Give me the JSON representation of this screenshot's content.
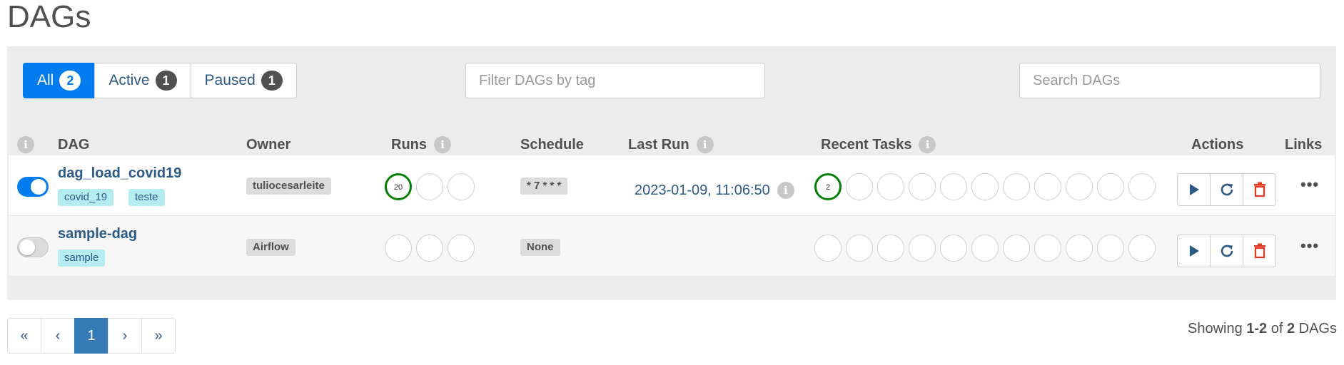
{
  "page": {
    "title": "DAGs"
  },
  "filters": {
    "all": {
      "label": "All",
      "count": "2"
    },
    "active": {
      "label": "Active",
      "count": "1"
    },
    "paused": {
      "label": "Paused",
      "count": "1"
    },
    "tag_placeholder": "Filter DAGs by tag",
    "search_placeholder": "Search DAGs"
  },
  "columns": {
    "info": "i",
    "dag": "DAG",
    "owner": "Owner",
    "runs": "Runs",
    "schedule": "Schedule",
    "last_run": "Last Run",
    "recent_tasks": "Recent Tasks",
    "actions": "Actions",
    "links": "Links"
  },
  "dags": [
    {
      "name": "dag_load_covid19",
      "active": true,
      "tags": [
        "covid_19",
        "teste"
      ],
      "owner": "tuliocesarleite",
      "runs": [
        {
          "count": "20",
          "state": "success"
        },
        {
          "count": ""
        },
        {
          "count": ""
        }
      ],
      "schedule": "* 7 * * *",
      "last_run": "2023-01-09, 11:06:50",
      "recent_tasks": [
        {
          "count": "2",
          "state": "success"
        }
      ],
      "links_label": "•••"
    },
    {
      "name": "sample-dag",
      "active": false,
      "tags": [
        "sample"
      ],
      "owner": "Airflow",
      "runs": [],
      "schedule": "None",
      "last_run": "",
      "recent_tasks": [],
      "links_label": "•••"
    }
  ],
  "colors": {
    "accent": "#017cee",
    "success": "#008000",
    "delete": "#e43921",
    "tag_bg": "#b4ecef"
  },
  "icons": {
    "trigger": "play-icon",
    "refresh": "refresh-icon",
    "delete": "trash-icon",
    "links": "more-dots-icon"
  },
  "pagination": {
    "first": "«",
    "prev": "‹",
    "current": "1",
    "next": "›",
    "last": "»"
  },
  "footer": {
    "showing_prefix": "Showing ",
    "range": "1-2",
    "of": " of ",
    "total": "2",
    "suffix": " DAGs"
  }
}
